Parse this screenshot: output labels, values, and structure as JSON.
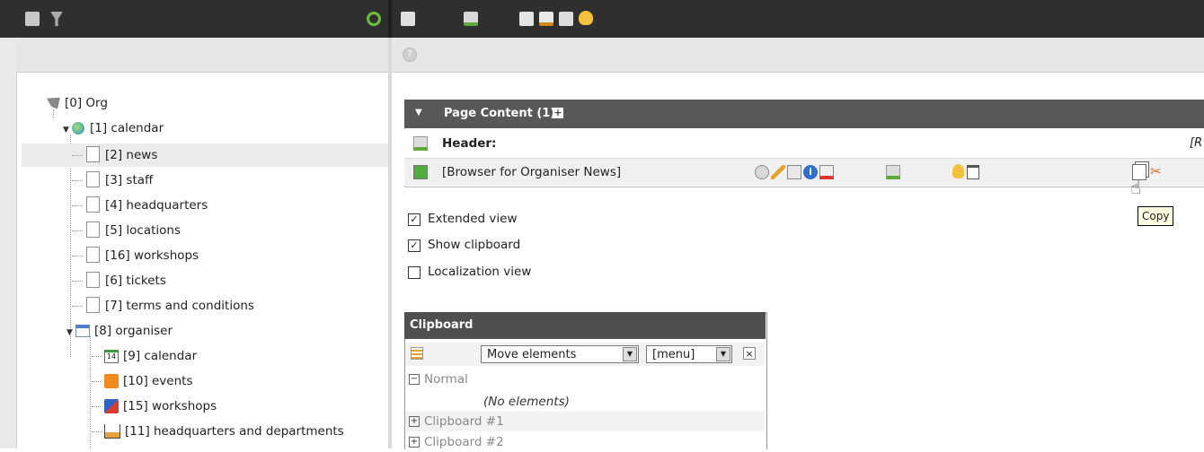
{
  "tree": {
    "items": [
      {
        "label": "[0] Org",
        "icon": "typo3-root-icon"
      },
      {
        "label": "[1] calendar",
        "icon": "globe-icon"
      },
      {
        "label": "[2] news",
        "icon": "page-icon"
      },
      {
        "label": "[3] staff",
        "icon": "page-icon"
      },
      {
        "label": "[4] headquarters",
        "icon": "page-icon"
      },
      {
        "label": "[5] locations",
        "icon": "page-icon"
      },
      {
        "label": "[16] workshops",
        "icon": "page-icon"
      },
      {
        "label": "[6] tickets",
        "icon": "page-icon"
      },
      {
        "label": "[7] terms and conditions",
        "icon": "page-icon"
      },
      {
        "label": "[8] organiser",
        "icon": "calendar-folder-icon"
      },
      {
        "label": "[9] calendar",
        "icon": "calendar-14-icon"
      },
      {
        "label": "[10] events",
        "icon": "events-icon"
      },
      {
        "label": "[15] workshops",
        "icon": "workshops-icon"
      },
      {
        "label": "[11] headquarters and departments",
        "icon": "house-icon"
      }
    ]
  },
  "page_content": {
    "header_title": "Page Content (1)",
    "header_label": "Header:",
    "header_right_fragment": "[R",
    "element_label": "[Browser for Organiser News]"
  },
  "options": {
    "extended_view": {
      "label": "Extended view",
      "checked": true
    },
    "show_clipboard": {
      "label": "Show clipboard",
      "checked": true
    },
    "localization_view": {
      "label": "Localization view",
      "checked": false
    }
  },
  "clipboard": {
    "title": "Clipboard",
    "mode_select": "Move elements",
    "menu_select": "[menu]",
    "close": "×",
    "normal_label": "Normal",
    "no_elements": "(No elements)",
    "pads": [
      "Clipboard #1",
      "Clipboard #2"
    ]
  },
  "tooltip": {
    "text": "Copy"
  },
  "colors": {
    "topbar": "#2f2f2f",
    "section_header": "#585858",
    "clipboard_header": "#4f4f4f",
    "tooltip_bg": "#ffffe1"
  }
}
